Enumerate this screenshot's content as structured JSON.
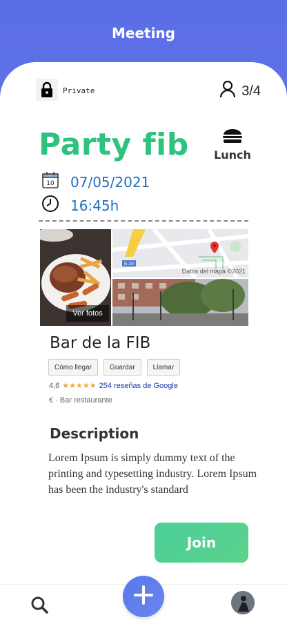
{
  "header": {
    "title": "Meeting"
  },
  "meeting": {
    "privacy": "Private",
    "participants": "3/4",
    "title": "Party fib",
    "category": "Lunch",
    "date": "07/05/2021",
    "time": "16:45h"
  },
  "place": {
    "photos_label": "Ver fotos",
    "map_credit": "Datos del mapa ©2021",
    "name": "Bar de la FIB",
    "actions": [
      "Cómo llegar",
      "Guardar",
      "Llamar"
    ],
    "rating": "4,6",
    "stars": "★★★★★",
    "reviews": "254 reseñas de Google",
    "type": "€ · Bar restaurante"
  },
  "description": {
    "title": "Description",
    "text": "Lorem Ipsum is simply dummy text of the printing and typesetting industry. Lorem Ipsum has been the industry's standard"
  },
  "join_label": "Join",
  "nav": {
    "icons": [
      "search-icon",
      "add-icon",
      "avatar"
    ]
  },
  "colors": {
    "accent_green": "#2ec27e",
    "header_blue": "#5a6ee6",
    "date_blue": "#1f6fbd"
  }
}
